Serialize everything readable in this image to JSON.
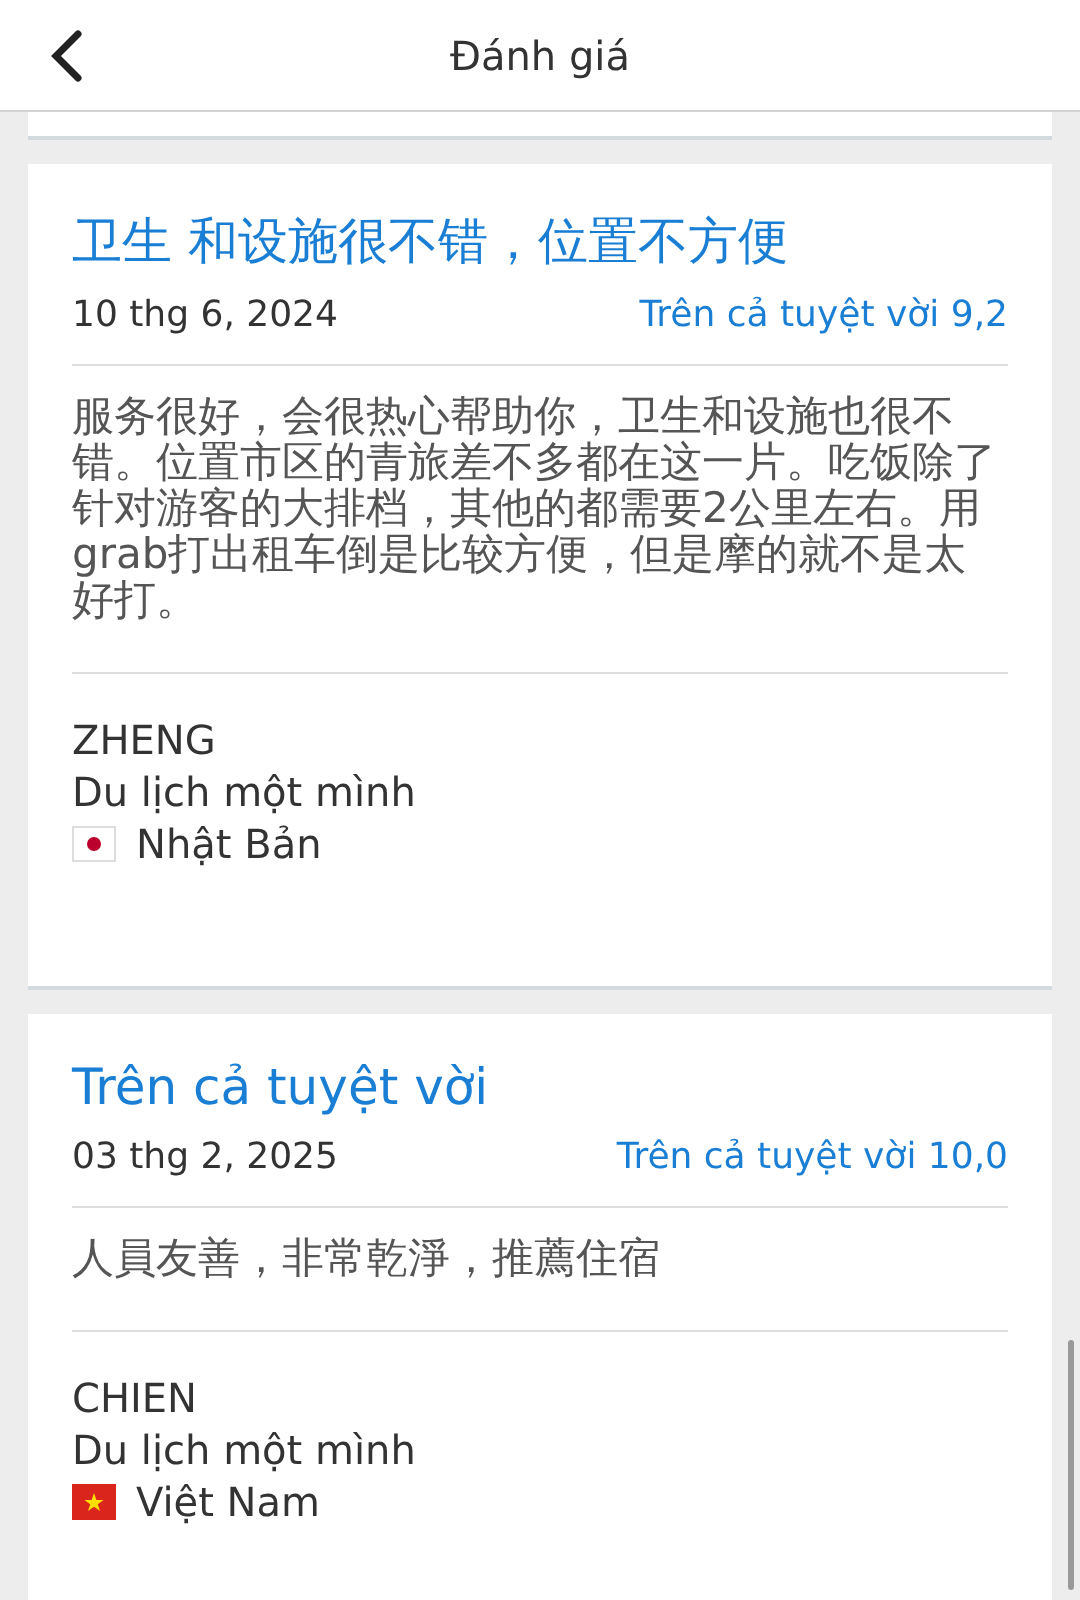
{
  "header": {
    "title": "Đánh giá"
  },
  "reviews": [
    {
      "title": "卫生 和设施很不错，位置不方便",
      "date": "10 thg 6, 2024",
      "score": "Trên cả tuyệt vời 9,2",
      "text": "服务很好，会很热心帮助你，卫生和设施也很不错。位置市区的青旅差不多都在这一片。吃饭除了针对游客的大排档，其他的都需要2公里左右。用grab打出租车倒是比较方便，但是摩的就不是太好打。",
      "name": "ZHENG",
      "trip": "Du lịch một mình",
      "country": "Nhật Bản",
      "kind": "jp"
    },
    {
      "title": "Trên cả tuyệt vời",
      "date": "03 thg 2, 2025",
      "score": "Trên cả tuyệt vời 10,0",
      "text": "人員友善，非常乾淨，推薦住宿",
      "name": "CHIEN",
      "trip": "Du lịch một mình",
      "country": "Việt Nam",
      "kind": "vn"
    }
  ]
}
